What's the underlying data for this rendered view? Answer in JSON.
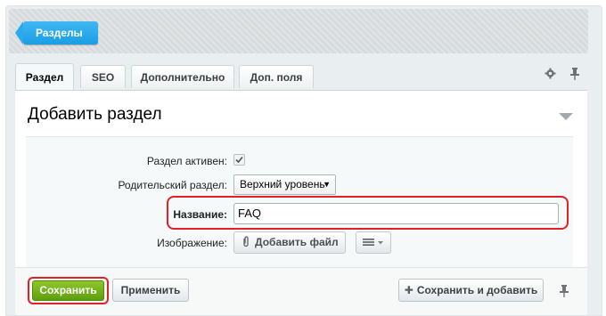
{
  "header": {
    "sections_button": "Разделы"
  },
  "tabs": [
    {
      "label": "Раздел",
      "active": true
    },
    {
      "label": "SEO",
      "active": false
    },
    {
      "label": "Дополнительно",
      "active": false
    },
    {
      "label": "Доп. поля",
      "active": false
    }
  ],
  "icons": {
    "settings": "gear-icon",
    "pin": "pin-icon",
    "collapse": "triangle-down-icon"
  },
  "panel": {
    "title": "Добавить раздел"
  },
  "form": {
    "active_label": "Раздел активен:",
    "active_checked": true,
    "parent_label": "Родительский раздел:",
    "parent_value": "Верхний уровень",
    "name_label": "Название:",
    "name_value": "FAQ",
    "image_label": "Изображение:",
    "add_file_label": "Добавить файл"
  },
  "footer": {
    "save_label": "Сохранить",
    "apply_label": "Применить",
    "save_add_label": "Сохранить и добавить"
  },
  "colors": {
    "accent_blue": "#1a9ee3",
    "save_green": "#6aab14",
    "highlight_red": "#e12127"
  }
}
